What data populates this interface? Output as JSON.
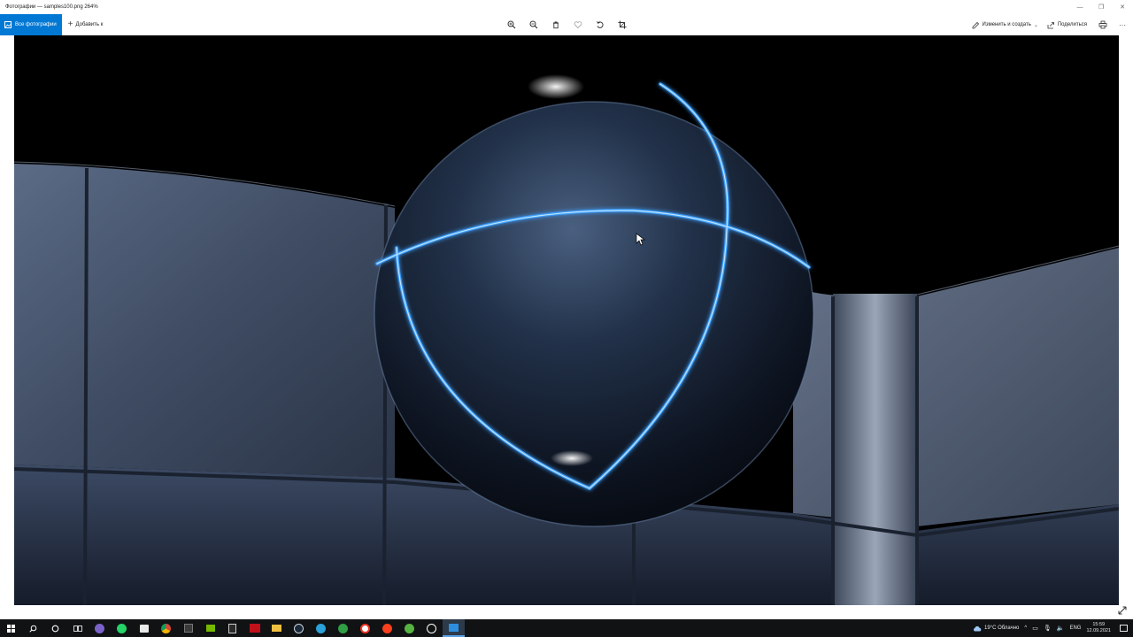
{
  "window": {
    "title": "Фотографии — samples100.png   264%",
    "controls": [
      "—",
      "❐",
      "✕"
    ]
  },
  "toolbar": {
    "all_photos_label": "Все фотографии",
    "add_to_label": "Добавить к",
    "edit_create_label": "Изменить и создать",
    "share_label": "Поделиться",
    "more_label": "···",
    "accent_color": "#0078d4"
  },
  "tools": {
    "zoom_in": "zoom-in-icon",
    "zoom_out": "zoom-out-icon",
    "delete": "trash-icon",
    "favorite": "heart-icon",
    "rotate": "rotate-icon",
    "crop": "crop-icon",
    "print": "print-icon"
  },
  "image": {
    "description_icon": "rendered-sphere-photo"
  },
  "taskbar": {
    "weather": "19°C  Облачно",
    "language": "ENG",
    "time": "15:59",
    "date": "12.09.2021",
    "apps": [
      "start",
      "search",
      "cortana",
      "task-view",
      "viber",
      "whatsapp",
      "store",
      "chrome",
      "app-dark",
      "nvidia",
      "epic-games",
      "app-red",
      "file-explorer",
      "steam",
      "telegram",
      "xbox",
      "yandex-browser",
      "yandex",
      "utorrent",
      "unreal-engine",
      "photos"
    ]
  }
}
